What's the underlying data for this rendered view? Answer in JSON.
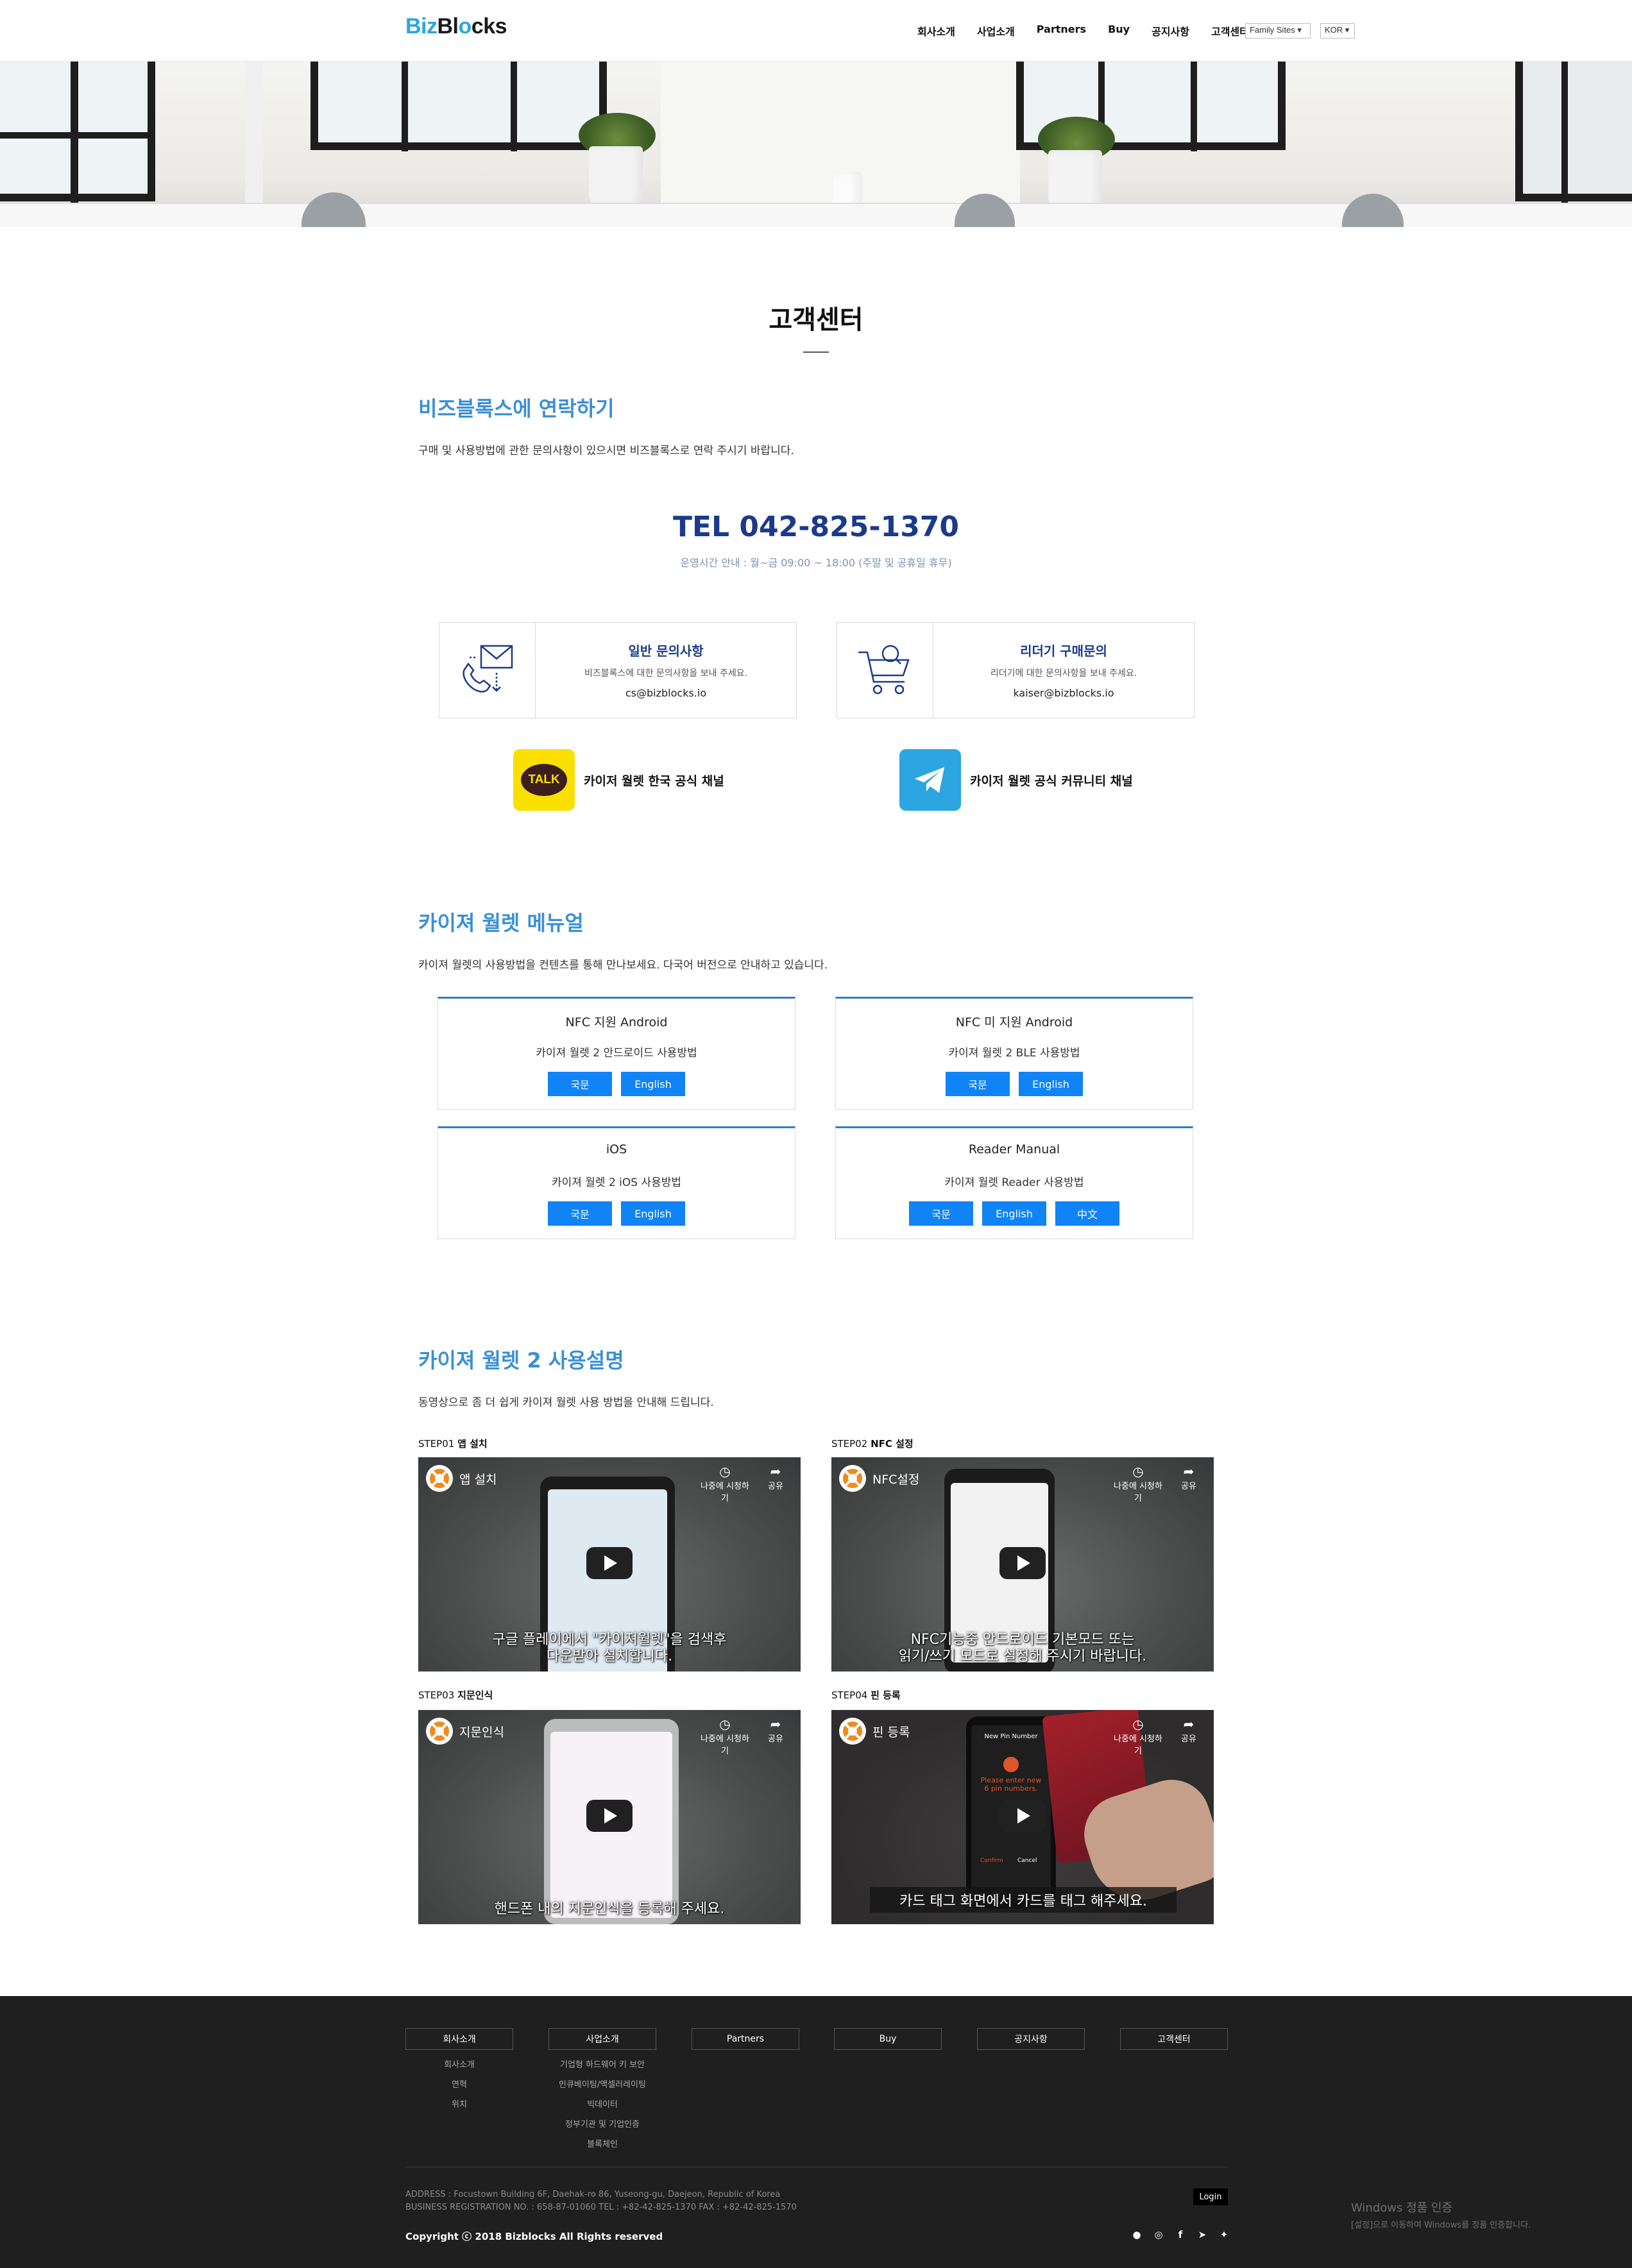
{
  "header": {
    "logo_biz": "Biz",
    "logo_bl": "Bl",
    "logo_o": "o",
    "logo_cks": "cks",
    "nav": [
      "회사소개",
      "사업소개",
      "Partners",
      "Buy",
      "공지사항",
      "고객센터"
    ],
    "family_sites": "Family Sites ▾",
    "language": "KOR ▾"
  },
  "page_title": "고객센터",
  "contact": {
    "title": "비즈블록스에 연락하기",
    "desc": "구매 및 사용방법에 관한 문의사항이 있으시면 비즈블록스로 연락 주시기 바랍니다.",
    "tel": "TEL 042-825-1370",
    "hours": "운영시간 안내 : 월~금 09:00 ~ 18:00 (주말 및 공휴일 휴무)",
    "cards": [
      {
        "title": "일반 문의사항",
        "sub": "비즈블록스에 대한 문의사항을 보내 주세요.",
        "email": "cs@bizblocks.io",
        "icon": "phone-mail-icon"
      },
      {
        "title": "리더기 구매문의",
        "sub": "리더기에 대한 문의사항을 보내 주세요.",
        "email": "kaiser@bizblocks.io",
        "icon": "shopping-cart-icon"
      }
    ],
    "channels": [
      {
        "label": "카이저 월렛 한국 공식 채널",
        "badge_text": "TALK",
        "icon": "kakaotalk-icon",
        "color": "#f9e000"
      },
      {
        "label": "카이저 월렛 공식 커뮤니티 채널",
        "icon": "telegram-icon",
        "color": "#2ca5e0"
      }
    ]
  },
  "manual": {
    "title": "카이져 월렛 메뉴얼",
    "desc": "카이져 월렛의 사용방법을 컨텐츠를 통해 만나보세요. 다국어 버전으로 안내하고 있습니다.",
    "cards": [
      {
        "title": "NFC 지원 Android",
        "sub": "카이져 월렛 2 안드로이드 사용방법",
        "buttons": [
          "국문",
          "English"
        ]
      },
      {
        "title": "NFC 미 지원 Android",
        "sub": "카이져 월렛 2 BLE 사용방법",
        "buttons": [
          "국문",
          "English"
        ]
      },
      {
        "title": "iOS",
        "sub": "카이져 월렛 2 iOS 사용방법",
        "buttons": [
          "국문",
          "English"
        ]
      },
      {
        "title": "Reader Manual",
        "sub": "카이져 월렛 Reader 사용방법",
        "buttons": [
          "국문",
          "English",
          "中文"
        ]
      }
    ]
  },
  "guide": {
    "title": "카이져 월렛 2 사용설명",
    "desc": "동영상으로 좀 더 쉽게 카이져 월렛 사용 방법을 안내해 드립니다.",
    "watch_later": "나중에 시청하기",
    "share": "공유",
    "steps": [
      {
        "step": "STEP01",
        "name": "앱 설치",
        "video_title": "앱 설치",
        "caption1": "구글 플레이에서 \"카이져월렛\"을 검색후",
        "caption2": "다운받아 설치합니다."
      },
      {
        "step": "STEP02",
        "name": "NFC 설정",
        "video_title": "NFC설정",
        "caption1": "NFC기능중 안드로이드 기본모드 또는",
        "caption2": "읽기/쓰기 모드로 설정해 주시기 바랍니다."
      },
      {
        "step": "STEP03",
        "name": "지문인식",
        "video_title": "지문인식",
        "caption1": "핸드폰 내의 지문인식을 등록해 주세요.",
        "caption2": ""
      },
      {
        "step": "STEP04",
        "name": "핀 등록",
        "video_title": "핀 등록",
        "caption1": "카드 태그 화면에서 카드를 태그 해주세요.",
        "caption2": "",
        "screen_title": "New Pin Number",
        "screen_text": "Please enter new 6 pin numbers.",
        "screen_btn1": "Confirm",
        "screen_btn2": "Cancel"
      }
    ]
  },
  "footer": {
    "columns": [
      {
        "head": "회사소개",
        "items": [
          "회사소개",
          "연혁",
          "위치"
        ]
      },
      {
        "head": "사업소개",
        "items": [
          "기업형 하드웨어 키 보안",
          "인큐베이팅/액셀러레이팅",
          "빅데이터",
          "정부기관 및 기업인증",
          "블록체인"
        ]
      },
      {
        "head": "Partners",
        "items": []
      },
      {
        "head": "Buy",
        "items": []
      },
      {
        "head": "공지사항",
        "items": []
      },
      {
        "head": "고객센터",
        "items": []
      }
    ],
    "address": "ADDRESS : Focustown Building 6F, Daehak-ro 86, Yuseong-gu, Daejeon, Republic of Korea",
    "registration": "BUSINESS REGISTRATION NO. : 658-87-01060 TEL : +82-42-825-1370 FAX : +82-42-825-1570",
    "copyright": "Copyright ⓒ 2018 Bizblocks All Rights reserved",
    "login": "Login"
  },
  "windows_activation": {
    "title": "Windows 정품 인증",
    "sub": "[설정]으로 이동하여 Windows를 정품 인증합니다."
  }
}
